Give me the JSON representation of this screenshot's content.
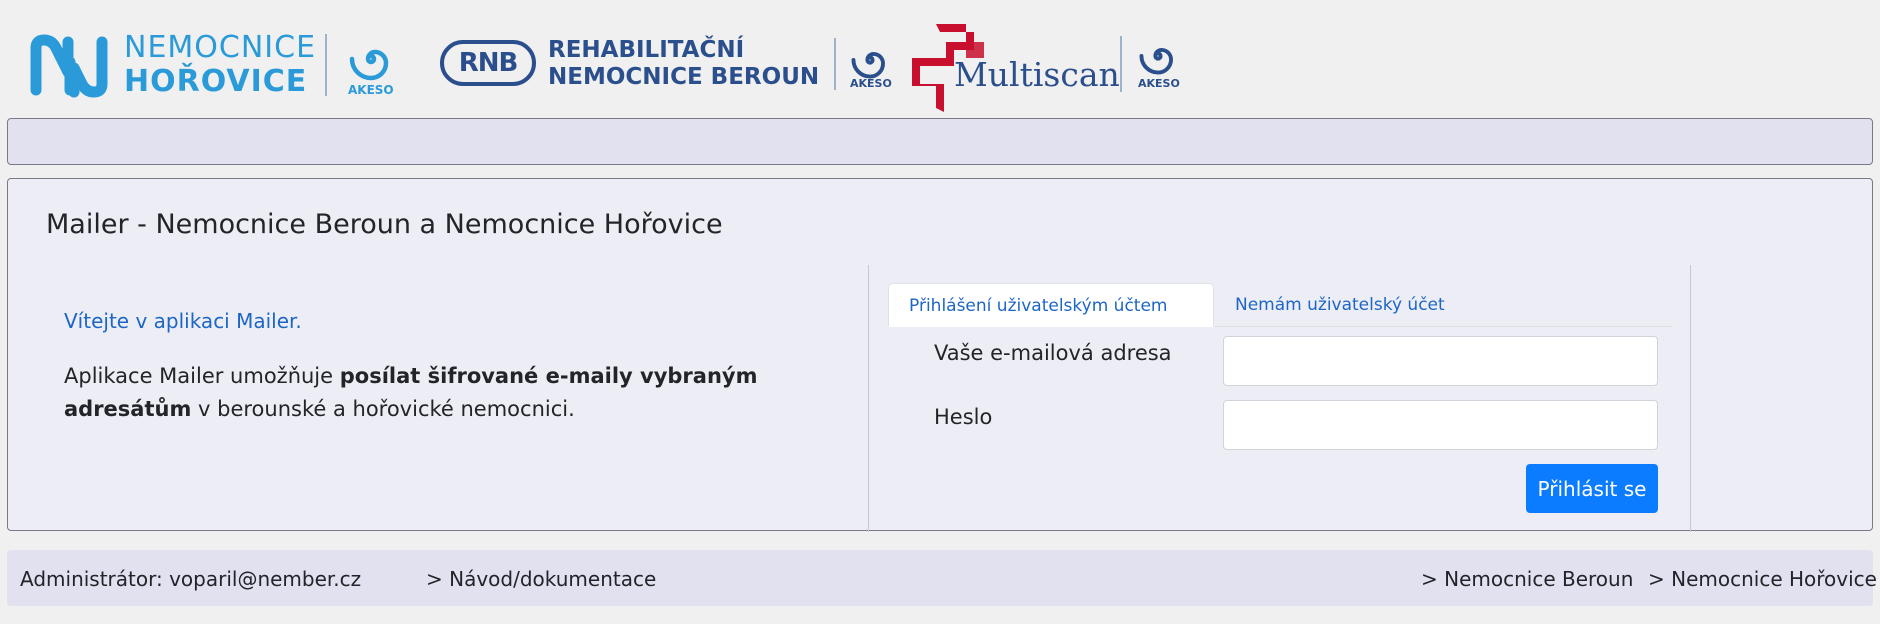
{
  "header": {
    "logos": [
      {
        "name": "nemocnice-horovice",
        "monogram": "NH",
        "line1": "NEMOCNICE",
        "line2": "HOŘOVICE",
        "sub": "AKESO"
      },
      {
        "name": "rnb",
        "monogram": "RNB",
        "line1": "REHABILITAČNÍ",
        "line2": "NEMOCNICE BEROUN",
        "sub": "AKESO"
      },
      {
        "name": "multiscan",
        "wordmark": "Multiscan",
        "sub": "AKESO"
      }
    ]
  },
  "main": {
    "title": "Mailer - Nemocnice Beroun a Nemocnice Hořovice",
    "welcome": "Vítejte v aplikaci Mailer.",
    "intro_before": "Aplikace Mailer umožňuje ",
    "intro_bold": "posílat šifrované e-maily vybraným adresátům",
    "intro_after": " v berounské a hořovické nemocnici.",
    "tabs": [
      {
        "label": "Přihlášení uživatelským účtem",
        "active": true
      },
      {
        "label": "Nemám uživatelský účet",
        "active": false
      }
    ],
    "form": {
      "email_label": "Vaše e-mailová adresa",
      "email_value": "",
      "password_label": "Heslo",
      "password_value": "",
      "submit_label": "Přihlásit se"
    }
  },
  "footer": {
    "admin": "Administrátor: voparil@nember.cz",
    "docs": "> Návod/dokumentace",
    "link_beroun": "> Nemocnice Beroun",
    "link_horovice": "> Nemocnice Hořovice"
  },
  "colors": {
    "link_blue": "#1d66c5",
    "button_blue": "#0b7bff",
    "logo_blue": "#2a9bd8",
    "rnb_navy": "#2b4f8c",
    "multiscan_red": "#c8102e",
    "navbar_bg": "#e1e1ef",
    "card_bg": "#ededf5"
  }
}
